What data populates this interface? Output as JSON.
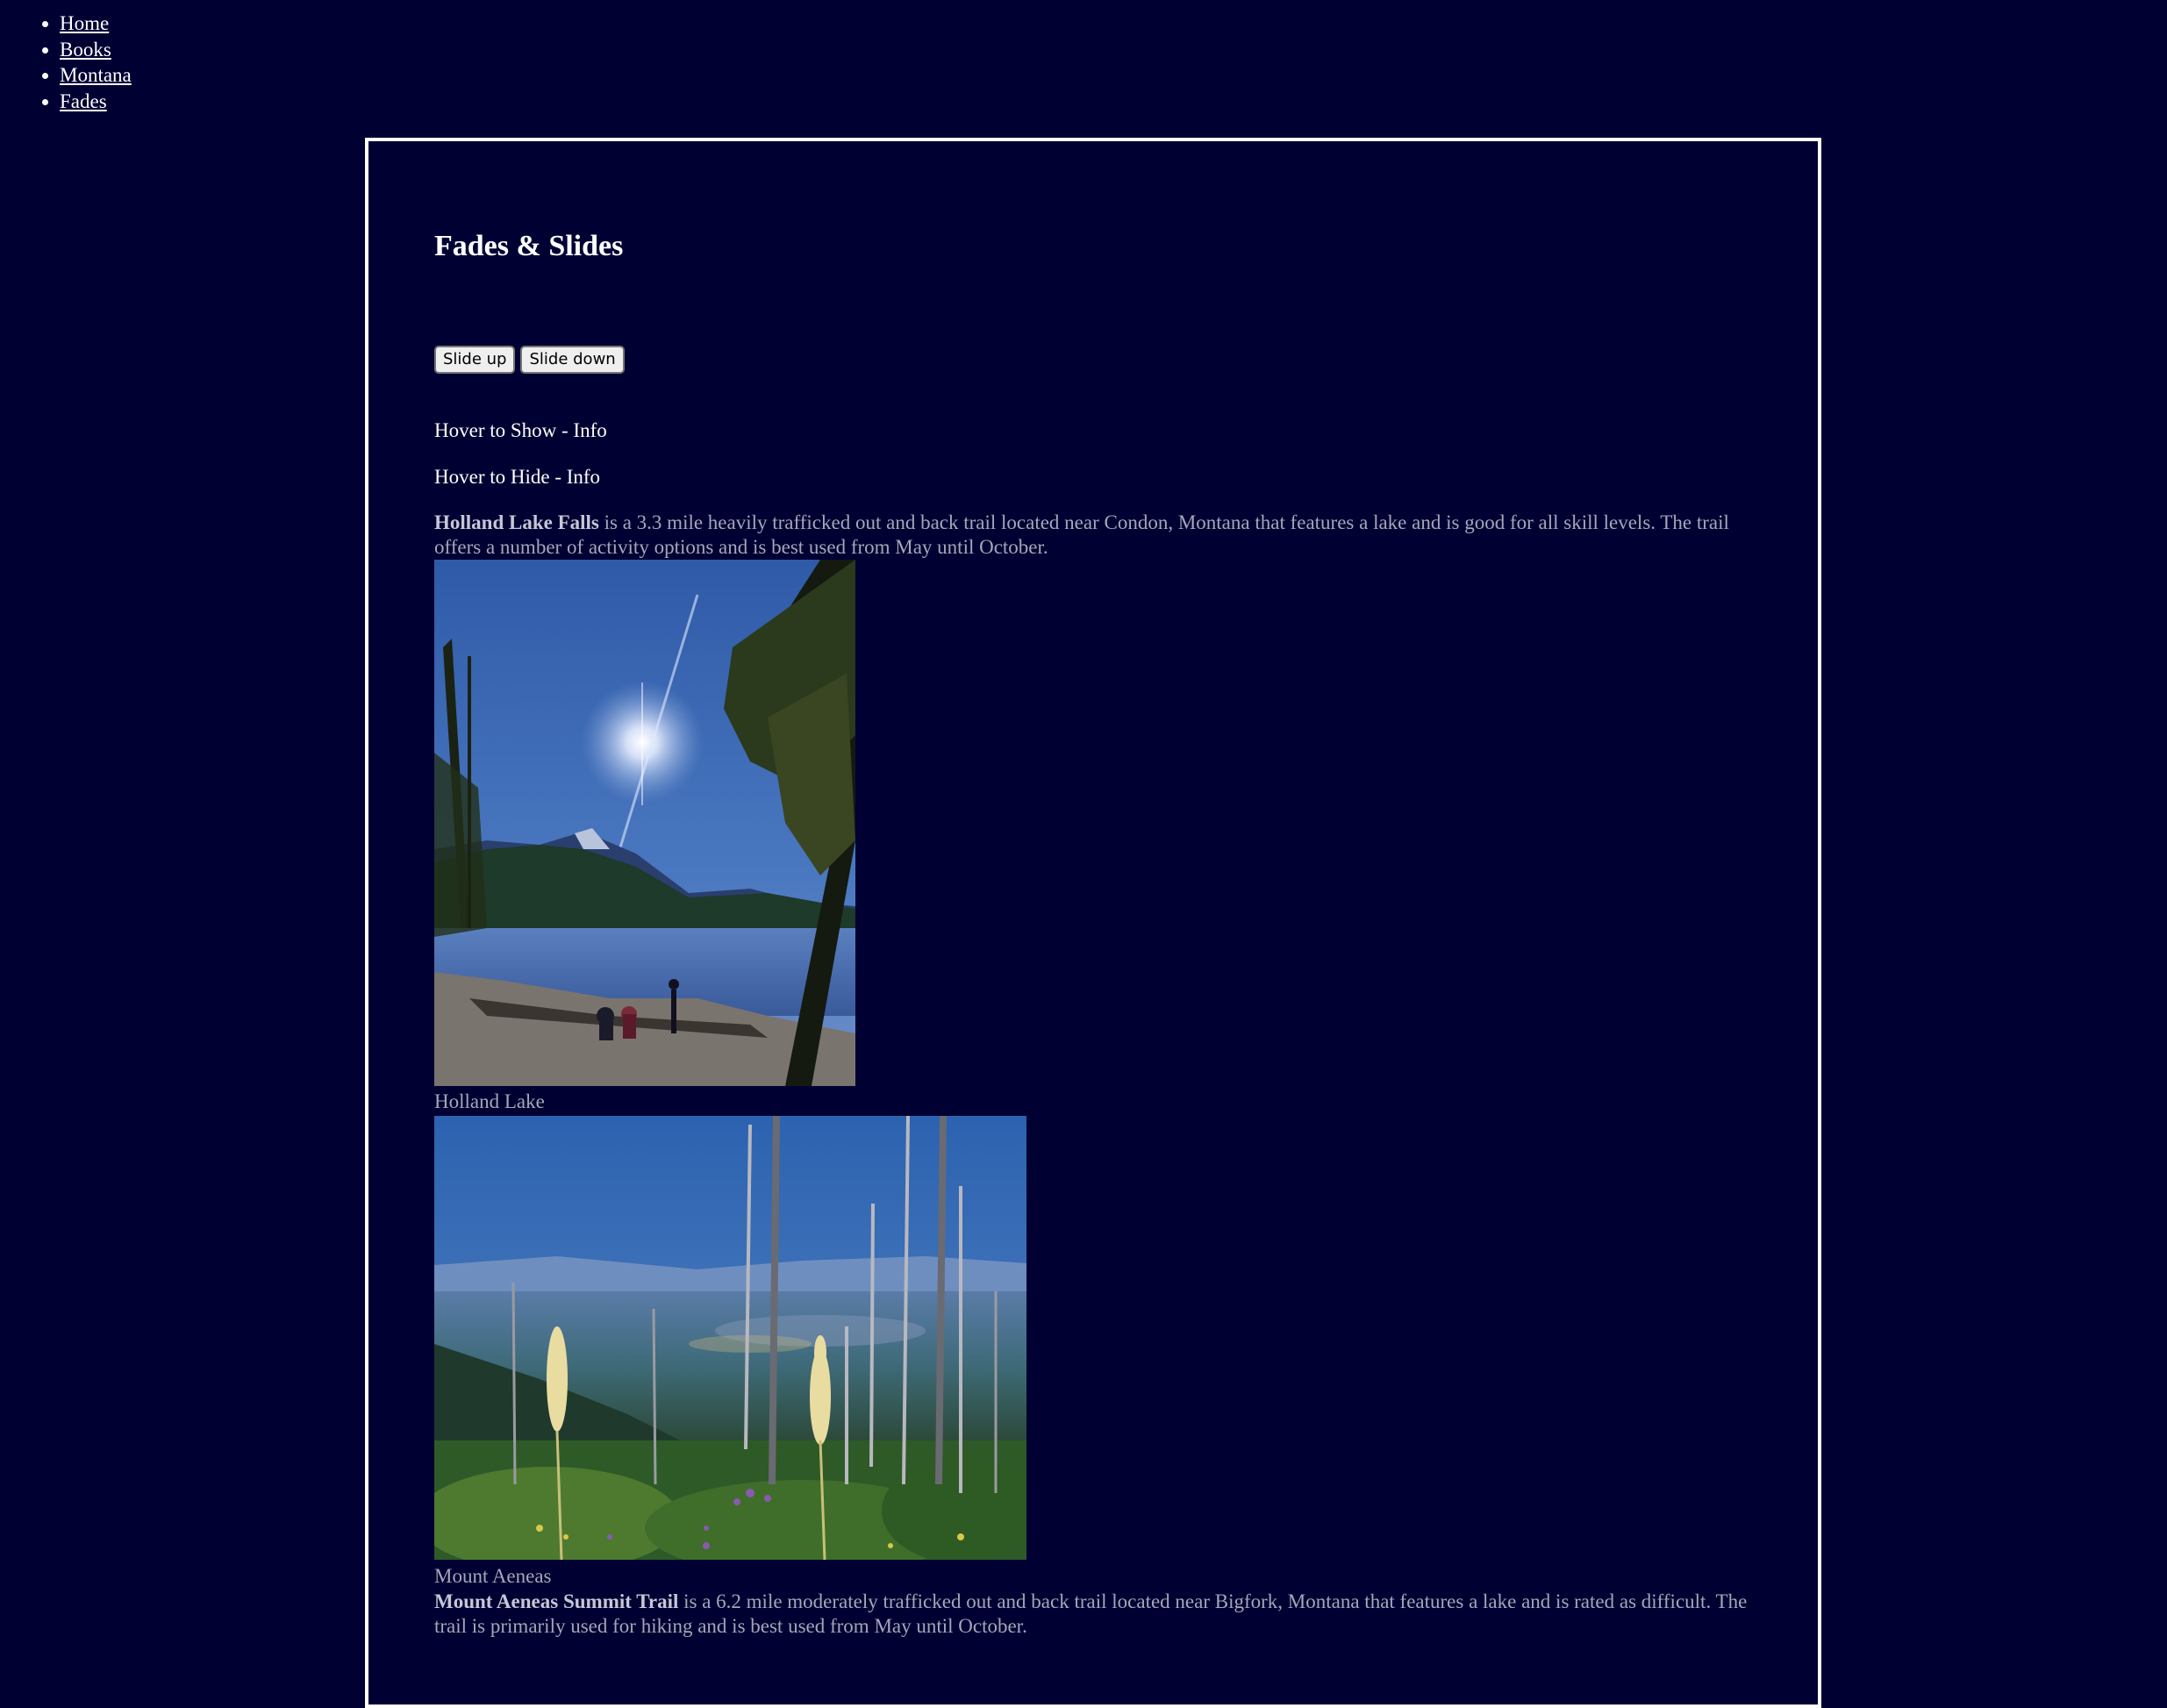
{
  "nav": {
    "items": [
      {
        "label": "Home"
      },
      {
        "label": "Books"
      },
      {
        "label": "Montana"
      },
      {
        "label": "Fades"
      }
    ]
  },
  "main": {
    "title": "Fades & Slides",
    "buttons": {
      "slide_up": "Slide up",
      "slide_down": "Slide down"
    },
    "hover_show": "Hover to Show - Info",
    "hover_hide": "Hover to Hide - Info",
    "holland": {
      "name": "Holland Lake Falls",
      "description": " is a 3.3 mile heavily trafficked out and back trail located near Condon, Montana that features a lake and is good for all skill levels. The trail offers a number of activity options and is best used from May until October.",
      "caption": "Holland Lake"
    },
    "aeneas": {
      "caption": "Mount Aeneas",
      "name": "Mount Aeneas Summit Trail",
      "description": " is a 6.2 mile moderately trafficked out and back trail located near Bigfork, Montana that features a lake and is rated as difficult. The trail is primarily used for hiking and is best used from May until October."
    }
  },
  "colors": {
    "background": "#000033",
    "border": "#ffffff",
    "muted_text": "#a6a6b8"
  }
}
